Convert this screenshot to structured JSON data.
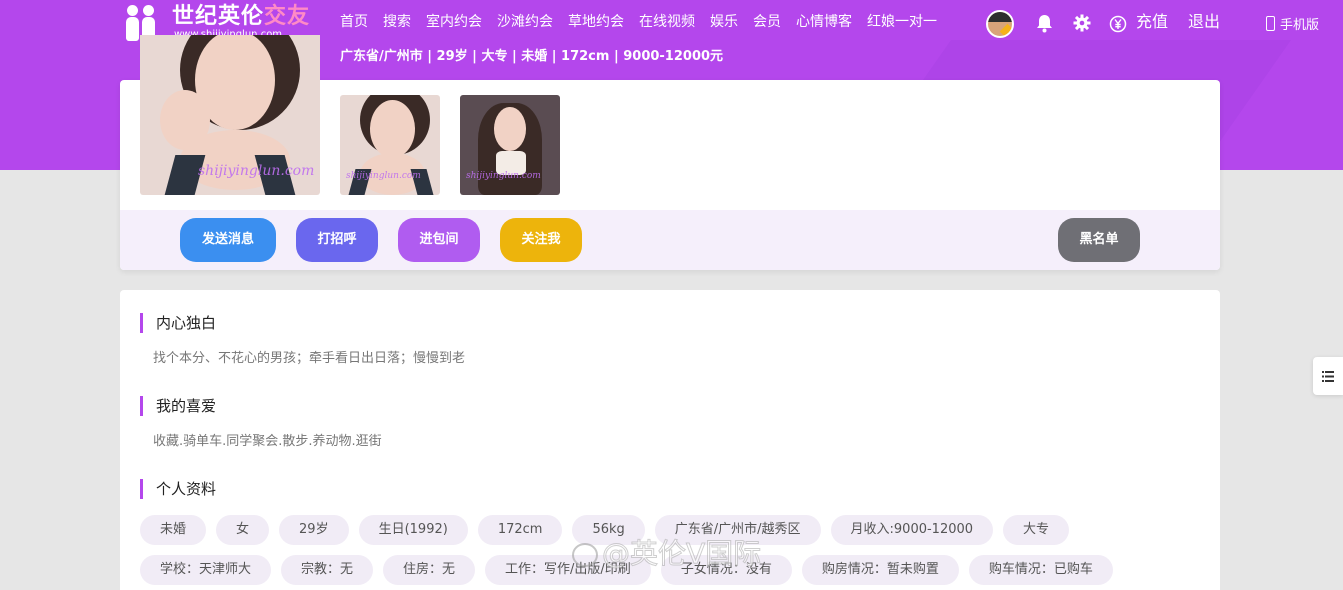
{
  "brand": {
    "title_main": "世纪英伦",
    "title_accent": "交友",
    "url": "www.shijiyinglun.com"
  },
  "nav": {
    "links": [
      "首页",
      "搜索",
      "室内约会",
      "沙滩约会",
      "草地约会",
      "在线视频",
      "娱乐",
      "会员",
      "心情博客",
      "红娘一对一"
    ],
    "recharge": "充值",
    "logout": "退出",
    "mobile": "手机版"
  },
  "profile": {
    "meta": "广东省/广州市 | 29岁 | 大专 | 未婚 | 172cm | 9000-12000元",
    "watermark": "shijiyinglun.com"
  },
  "actions": {
    "send_message": "发送消息",
    "greet": "打招呼",
    "private_room": "进包间",
    "follow": "关注我",
    "blacklist": "黑名单"
  },
  "sections": {
    "monologue_title": "内心独白",
    "monologue_text": "找个本分、不花心的男孩；牵手看日出日落；慢慢到老",
    "hobbies_title": "我的喜爱",
    "hobbies_text": "收藏.骑单车.同学聚会.散步.养动物.逛街",
    "personal_title": "个人资料"
  },
  "tags_row1": [
    "未婚",
    "女",
    "29岁",
    "生日(1992)",
    "172cm",
    "56kg",
    "广东省/广州市/越秀区",
    "月收入:9000-12000",
    "大专"
  ],
  "tags_row2": [
    "学校：天津师大",
    "宗教：无",
    "住房：无",
    "工作：写作/出版/印刷",
    "子女情况：没有",
    "购房情况：暂未购置",
    "购车情况：已购车"
  ],
  "overlay_watermark": "@英伦V国际",
  "colors": {
    "brand_purple": "#b447ec",
    "btn_message": "#3b8ff0",
    "btn_greet": "#6a67ee",
    "btn_room": "#b05cf0",
    "btn_follow": "#edb40c",
    "btn_blacklist": "#6f6f75"
  },
  "icons": [
    "logo-couple-icon",
    "bell-icon",
    "gear-icon",
    "yuan-icon",
    "mobile-phone-icon",
    "list-menu-icon",
    "weibo-icon"
  ]
}
